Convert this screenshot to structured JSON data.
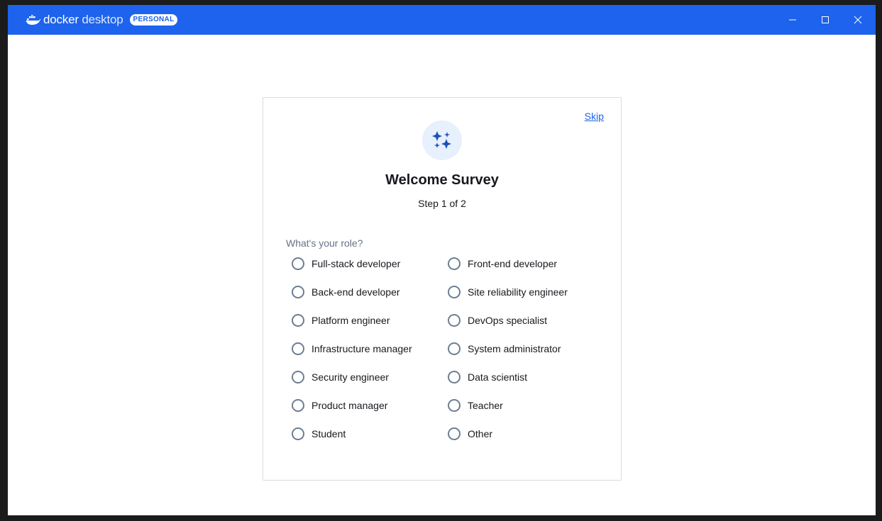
{
  "titlebar": {
    "app_name": "docker",
    "app_name_suffix": "desktop",
    "plan_badge": "PERSONAL",
    "controls": [
      "minimize-icon",
      "maximize-icon",
      "close-icon"
    ]
  },
  "survey": {
    "skip_label": "Skip",
    "hero_icon": "sparkles-icon",
    "title": "Welcome Survey",
    "step": "Step 1 of 2",
    "question": "What's your role?",
    "options_left": [
      "Full-stack developer",
      "Back-end developer",
      "Platform engineer",
      "Infrastructure manager",
      "Security engineer",
      "Product manager",
      "Student"
    ],
    "options_right": [
      "Front-end developer",
      "Site reliability engineer",
      "DevOps specialist",
      "System administrator",
      "Data scientist",
      "Teacher",
      "Other"
    ]
  },
  "colors": {
    "titlebar": "#1d63ed",
    "link": "#1d63ed",
    "radio_border": "#6c7e93",
    "hero_bg": "#e7f0fd",
    "icon": "#1d4fbd"
  }
}
